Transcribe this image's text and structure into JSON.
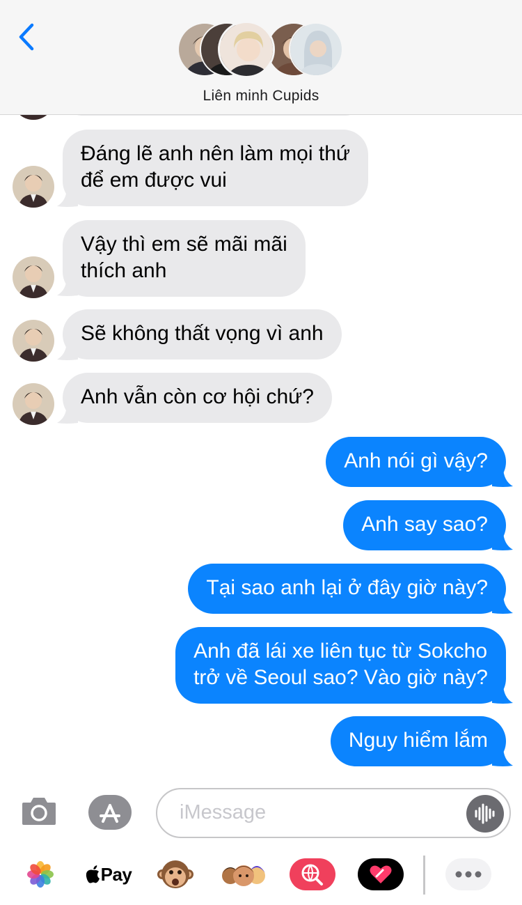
{
  "header": {
    "group_name": "Liên minh Cupids"
  },
  "messages": [
    {
      "dir": "in",
      "lines": [
        "Đáng lẽ anh nên làm mọi thứ",
        "để em được vui"
      ]
    },
    {
      "dir": "in",
      "lines": [
        "Vậy thì em sẽ mãi mãi",
        "thích anh"
      ]
    },
    {
      "dir": "in",
      "lines": [
        "Sẽ không thất vọng vì anh"
      ]
    },
    {
      "dir": "in",
      "lines": [
        "Anh vẫn còn cơ hội chứ?"
      ]
    },
    {
      "dir": "out",
      "lines": [
        "Anh nói gì vậy?"
      ]
    },
    {
      "dir": "out",
      "lines": [
        "Anh say sao?"
      ]
    },
    {
      "dir": "out",
      "lines": [
        "Tại sao anh lại ở đây giờ này?"
      ]
    },
    {
      "dir": "out",
      "lines": [
        "Anh đã lái xe liên tục từ Sokcho",
        "trở về Seoul sao? Vào giờ này?"
      ]
    },
    {
      "dir": "out",
      "lines": [
        "Nguy hiểm lắm"
      ]
    }
  ],
  "compose": {
    "placeholder": "iMessage"
  },
  "drawer": {
    "apple_pay_label": "Pay",
    "items": [
      "photos-app",
      "apple-pay-app",
      "animoji-app",
      "memoji-app",
      "web-images-app",
      "digital-touch-app",
      "more-apps"
    ]
  },
  "colors": {
    "outgoing": "#0b84fe",
    "incoming": "#e9e9eb",
    "accent": "#0a7aff"
  }
}
